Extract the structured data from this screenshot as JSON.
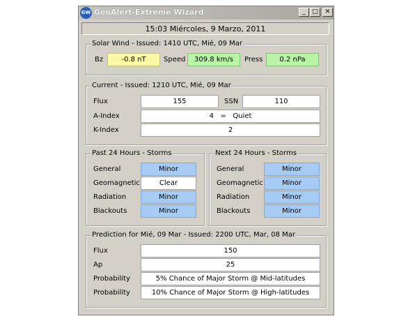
{
  "window": {
    "title": "GeoAlert-Extreme Wizard",
    "icon_text": "GW",
    "minimize_glyph": "_",
    "maximize_glyph": "□",
    "close_glyph": "✕"
  },
  "datetime": "15:03 Miércoles, 9 Marzo, 2011",
  "solar_wind": {
    "legend": "Solar Wind - Issued: 1410 UTC, Mié, 09 Mar",
    "bz_label": "Bz",
    "bz_value": "-0.8 nT",
    "speed_label": "Speed",
    "speed_value": "309.8 km/s",
    "press_label": "Press",
    "press_value": "0.2 nPa"
  },
  "current": {
    "legend": "Current - Issued: 1210 UTC, Mié, 09 Mar",
    "flux_label": "Flux",
    "flux_value": "155",
    "ssn_label": "SSN",
    "ssn_value": "110",
    "a_label": "A-Index",
    "a_value": "4   =   Quiet",
    "k_label": "K-Index",
    "k_value": "2"
  },
  "past": {
    "legend": "Past 24 Hours - Storms",
    "rows": [
      {
        "label": "General",
        "value": "Minor"
      },
      {
        "label": "Geomagnetic",
        "value": "Clear"
      },
      {
        "label": "Radiation",
        "value": "Minor"
      },
      {
        "label": "Blackouts",
        "value": "Minor"
      }
    ]
  },
  "next": {
    "legend": "Next 24 Hours - Storms",
    "rows": [
      {
        "label": "General",
        "value": "Minor"
      },
      {
        "label": "Geomagnetic",
        "value": "Minor"
      },
      {
        "label": "Radiation",
        "value": "Minor"
      },
      {
        "label": "Blackouts",
        "value": "Minor"
      }
    ]
  },
  "prediction": {
    "legend": "Prediction for Mié, 09 Mar - Issued: 2200 UTC, Mar, 08 Mar",
    "flux_label": "Flux",
    "flux_value": "150",
    "ap_label": "Ap",
    "ap_value": "25",
    "prob1_label": "Probability",
    "prob1_value": "5% Chance of Major Storm @ Mid-latitudes",
    "prob2_label": "Probability",
    "prob2_value": "10% Chance of Major Storm @ High-latitudes"
  },
  "colors": {
    "minor": "#a6cbf5",
    "clear": "#ffffff",
    "bz": "#fbf8a6",
    "speed": "#b8f3a8",
    "press": "#b8f3a8"
  }
}
